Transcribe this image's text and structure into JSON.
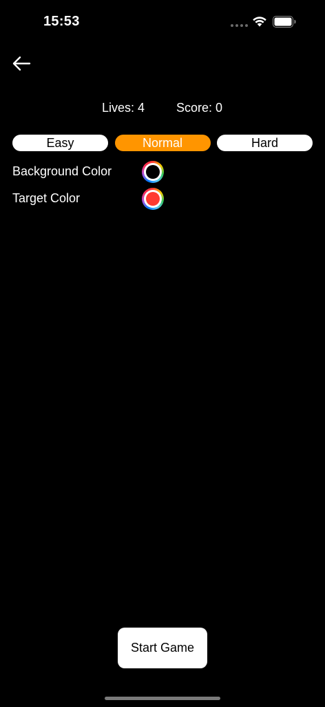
{
  "status_bar": {
    "time": "15:53",
    "wifi_icon": "wifi-icon",
    "battery_icon": "battery-icon"
  },
  "nav": {
    "back_icon": "arrow-left-icon"
  },
  "stats": {
    "lives": "Lives: 4",
    "score": "Score: 0"
  },
  "difficulty": {
    "options": [
      "Easy",
      "Normal",
      "Hard"
    ],
    "selected": "Normal"
  },
  "colors": {
    "background_label": "Background Color",
    "background_value": "#000000",
    "target_label": "Target Color",
    "target_value": "#ff3b30"
  },
  "actions": {
    "start_label": "Start Game"
  },
  "theme": {
    "accent": "#ff9500",
    "background": "#000000"
  }
}
